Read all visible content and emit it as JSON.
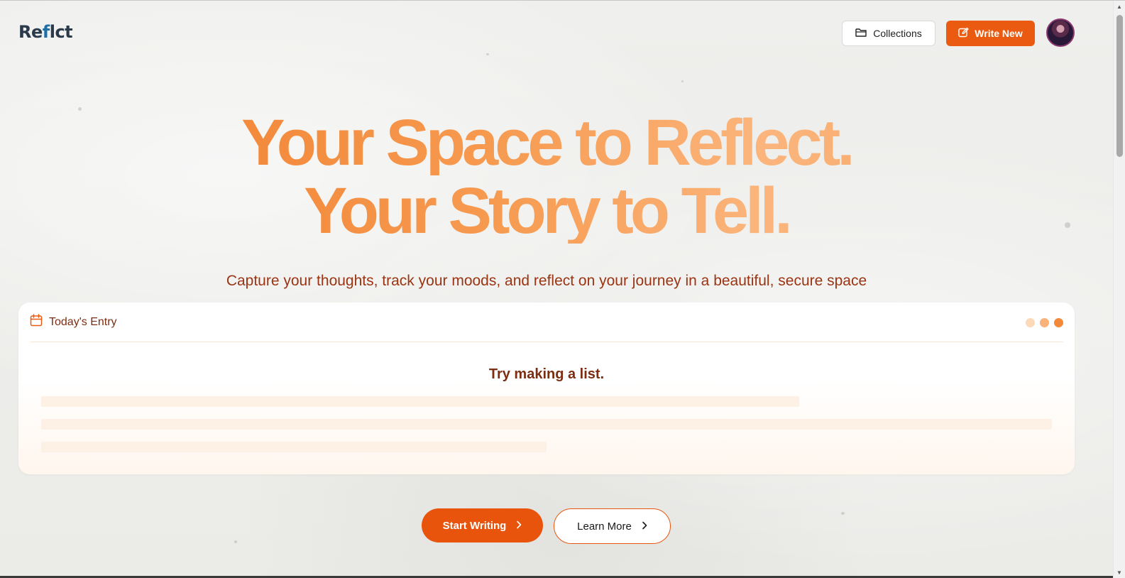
{
  "header": {
    "logo_text_1": "Re",
    "logo_text_2": "f",
    "logo_text_3": "lct",
    "collections_label": "Collections",
    "write_new_label": "Write New",
    "avatar_icon": "user-avatar"
  },
  "hero": {
    "line1": "Your Space to Reflect.",
    "line2": "Your Story to Tell.",
    "subtitle": "Capture your thoughts, track your moods, and reflect on your journey in a beautiful, secure space"
  },
  "entry_card": {
    "title": "Today's Entry",
    "prompt": "Try making a list.",
    "dot_colors": [
      "#fcd9b8",
      "#f8b27a",
      "#f28a3a"
    ]
  },
  "cta": {
    "start_label": "Start Writing",
    "learn_label": "Learn More"
  },
  "colors": {
    "accent": "#ea5a10",
    "text_brown": "#7c2d12"
  }
}
